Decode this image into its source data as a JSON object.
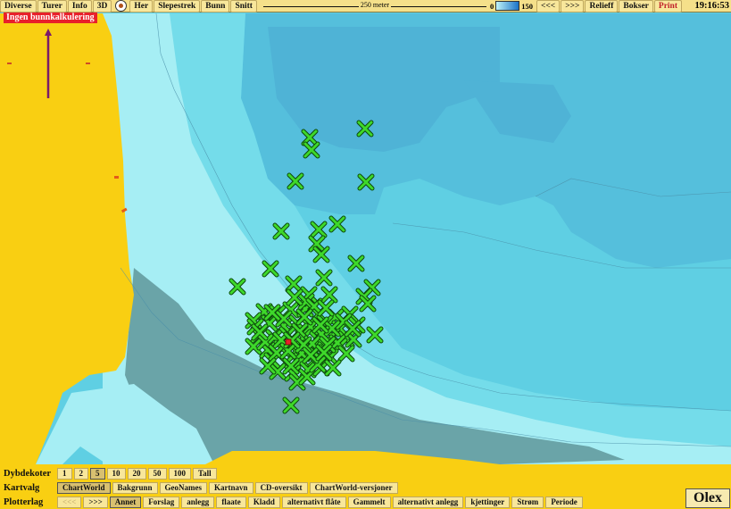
{
  "toolbar": {
    "buttons": [
      "Diverse",
      "Turer",
      "Info",
      "3D",
      "Her",
      "Slepestrek",
      "Bunn",
      "Snitt"
    ],
    "scale_label": "250 meter",
    "depth_min": "0",
    "depth_max": "150",
    "nav_back": "<<<",
    "nav_fwd": ">>>",
    "relieff": "Relieff",
    "bokser": "Bokser",
    "print": "Print",
    "clock": "19:16:53"
  },
  "warning": "Ingen bunnkalkulering",
  "dybdekoter": {
    "label": "Dybdekoter",
    "options": [
      "1",
      "2",
      "5",
      "10",
      "20",
      "50",
      "100",
      "Tall"
    ],
    "selected": "5"
  },
  "kartvalg": {
    "label": "Kartvalg",
    "options": [
      "ChartWorld",
      "Bakgrunn",
      "GeoNames",
      "Kartnavn",
      "CD-oversikt",
      "ChartWorld-versjoner"
    ],
    "selected": "ChartWorld"
  },
  "plotterlag": {
    "label": "Plotterlag",
    "nav_back": "<<<",
    "nav_fwd": ">>>",
    "options": [
      "Annet",
      "Forslag",
      "anlegg",
      "flaate",
      "Kladd",
      "alternativt flåte",
      "Gammelt",
      "alternativt anlegg",
      "kjettinger",
      "Strøm",
      "Periode"
    ],
    "selected": "Annet"
  },
  "brand": "Olex",
  "colors": {
    "land": "#f9cf12",
    "shallow": "#a8eff4",
    "mid": "#74dcea",
    "deep": "#58c4de",
    "deeper": "#52b6d8",
    "drying_zone": "#6aa4a8",
    "marker_fill": "#3ed82a",
    "marker_outline": "#0c4a0c",
    "toolbar_bg": "#f5e08a",
    "warning_bg": "#e8202a"
  },
  "markers": {
    "icon": "x-cross-marker",
    "count": 96
  }
}
